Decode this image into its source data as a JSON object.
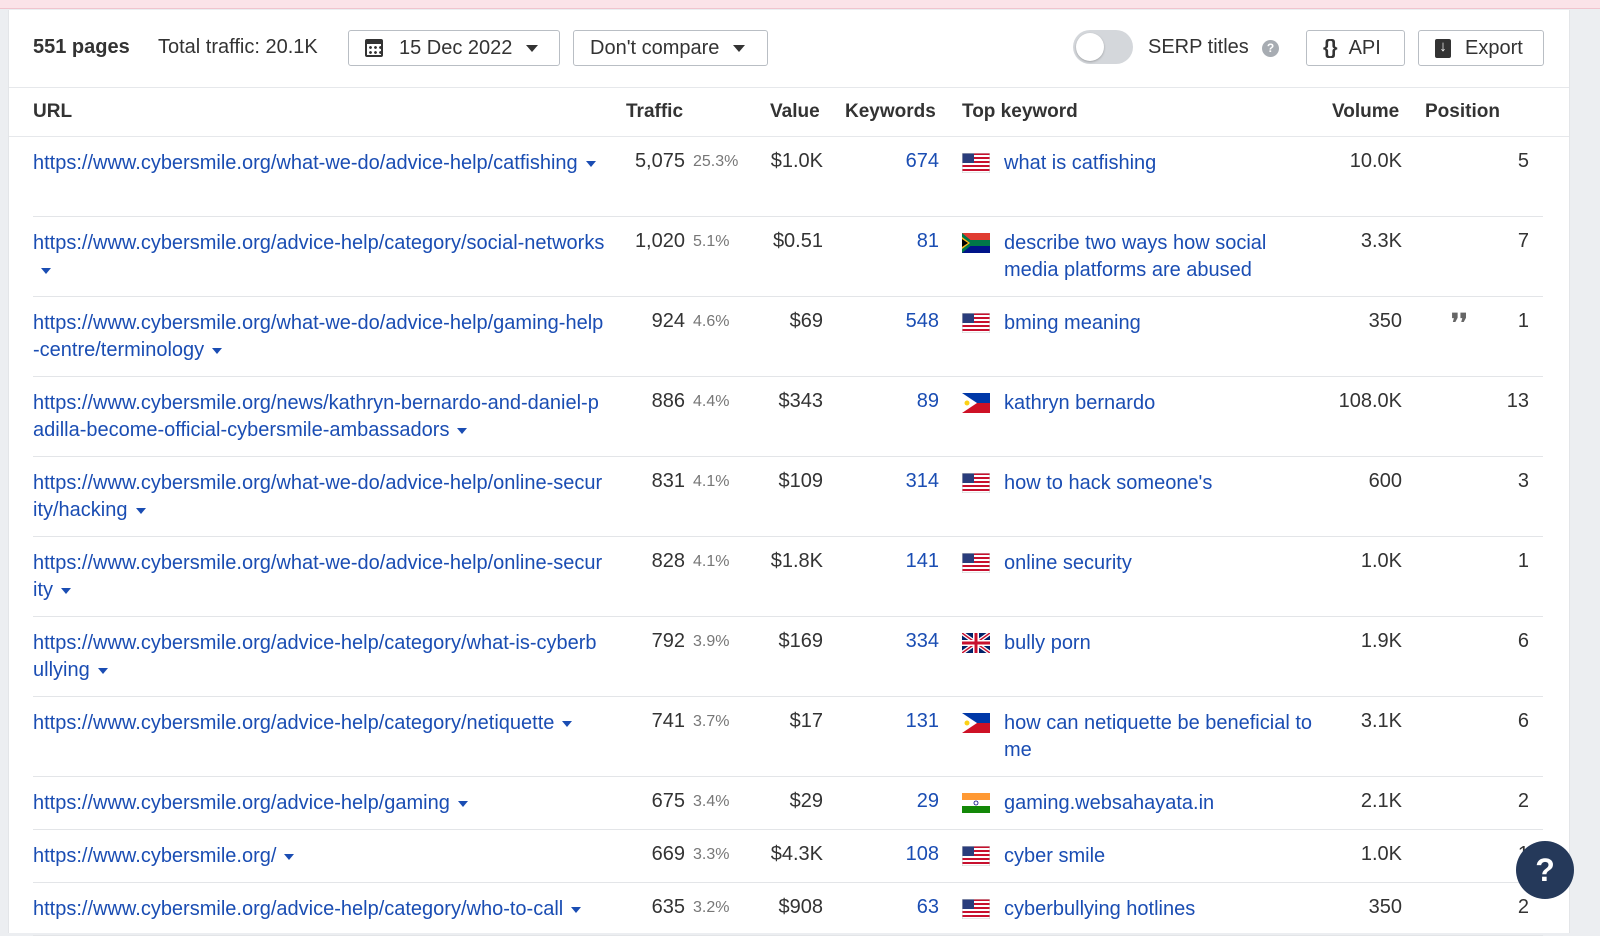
{
  "toolbar": {
    "pages_label": "551 pages",
    "total_traffic": "Total traffic: 20.1K",
    "date": "15 Dec 2022",
    "compare": "Don't compare",
    "serp_titles": "SERP titles",
    "api": "API",
    "export": "Export"
  },
  "columns": {
    "url": "URL",
    "traffic": "Traffic",
    "value": "Value",
    "keywords": "Keywords",
    "top_keyword": "Top keyword",
    "volume": "Volume",
    "position": "Position"
  },
  "rows": [
    {
      "url": "https://www.cybersmile.org/what-we-do/advice-help/catfishing",
      "traffic": "5,075",
      "pct": "25.3%",
      "value": "$1.0K",
      "keywords": "674",
      "flag": "us",
      "top_keyword": "what is catfishing",
      "volume": "10.0K",
      "position": "5",
      "quote": false
    },
    {
      "url": "https://www.cybersmile.org/advice-help/category/social-networks",
      "traffic": "1,020",
      "pct": "5.1%",
      "value": "$0.51",
      "keywords": "81",
      "flag": "za",
      "top_keyword": "describe two ways how social media platforms are abused",
      "volume": "3.3K",
      "position": "7",
      "quote": false
    },
    {
      "url": "https://www.cybersmile.org/what-we-do/advice-help/gaming-help-centre/terminology",
      "traffic": "924",
      "pct": "4.6%",
      "value": "$69",
      "keywords": "548",
      "flag": "us",
      "top_keyword": "bming meaning",
      "volume": "350",
      "position": "1",
      "quote": true
    },
    {
      "url": "https://www.cybersmile.org/news/kathryn-bernardo-and-daniel-padilla-become-official-cybersmile-ambassadors",
      "traffic": "886",
      "pct": "4.4%",
      "value": "$343",
      "keywords": "89",
      "flag": "ph",
      "top_keyword": "kathryn bernardo",
      "volume": "108.0K",
      "position": "13",
      "quote": false
    },
    {
      "url": "https://www.cybersmile.org/what-we-do/advice-help/online-security/hacking",
      "traffic": "831",
      "pct": "4.1%",
      "value": "$109",
      "keywords": "314",
      "flag": "us",
      "top_keyword": "how to hack someone's",
      "volume": "600",
      "position": "3",
      "quote": false
    },
    {
      "url": "https://www.cybersmile.org/what-we-do/advice-help/online-security",
      "traffic": "828",
      "pct": "4.1%",
      "value": "$1.8K",
      "keywords": "141",
      "flag": "us",
      "top_keyword": "online security",
      "volume": "1.0K",
      "position": "1",
      "quote": false
    },
    {
      "url": "https://www.cybersmile.org/advice-help/category/what-is-cyberbullying",
      "traffic": "792",
      "pct": "3.9%",
      "value": "$169",
      "keywords": "334",
      "flag": "gb",
      "top_keyword": "bully porn",
      "volume": "1.9K",
      "position": "6",
      "quote": false
    },
    {
      "url": "https://www.cybersmile.org/advice-help/category/netiquette",
      "traffic": "741",
      "pct": "3.7%",
      "value": "$17",
      "keywords": "131",
      "flag": "ph",
      "top_keyword": "how can netiquette be beneficial to me",
      "volume": "3.1K",
      "position": "6",
      "quote": false
    },
    {
      "url": "https://www.cybersmile.org/advice-help/gaming",
      "traffic": "675",
      "pct": "3.4%",
      "value": "$29",
      "keywords": "29",
      "flag": "in",
      "top_keyword": "gaming.websahayata.in",
      "volume": "2.1K",
      "position": "2",
      "quote": false
    },
    {
      "url": "https://www.cybersmile.org/",
      "traffic": "669",
      "pct": "3.3%",
      "value": "$4.3K",
      "keywords": "108",
      "flag": "us",
      "top_keyword": "cyber smile",
      "volume": "1.0K",
      "position": "1",
      "quote": false
    },
    {
      "url": "https://www.cybersmile.org/advice-help/category/who-to-call",
      "traffic": "635",
      "pct": "3.2%",
      "value": "$908",
      "keywords": "63",
      "flag": "us",
      "top_keyword": "cyberbullying hotlines",
      "volume": "350",
      "position": "2",
      "quote": false
    }
  ],
  "help_fab": "?"
}
